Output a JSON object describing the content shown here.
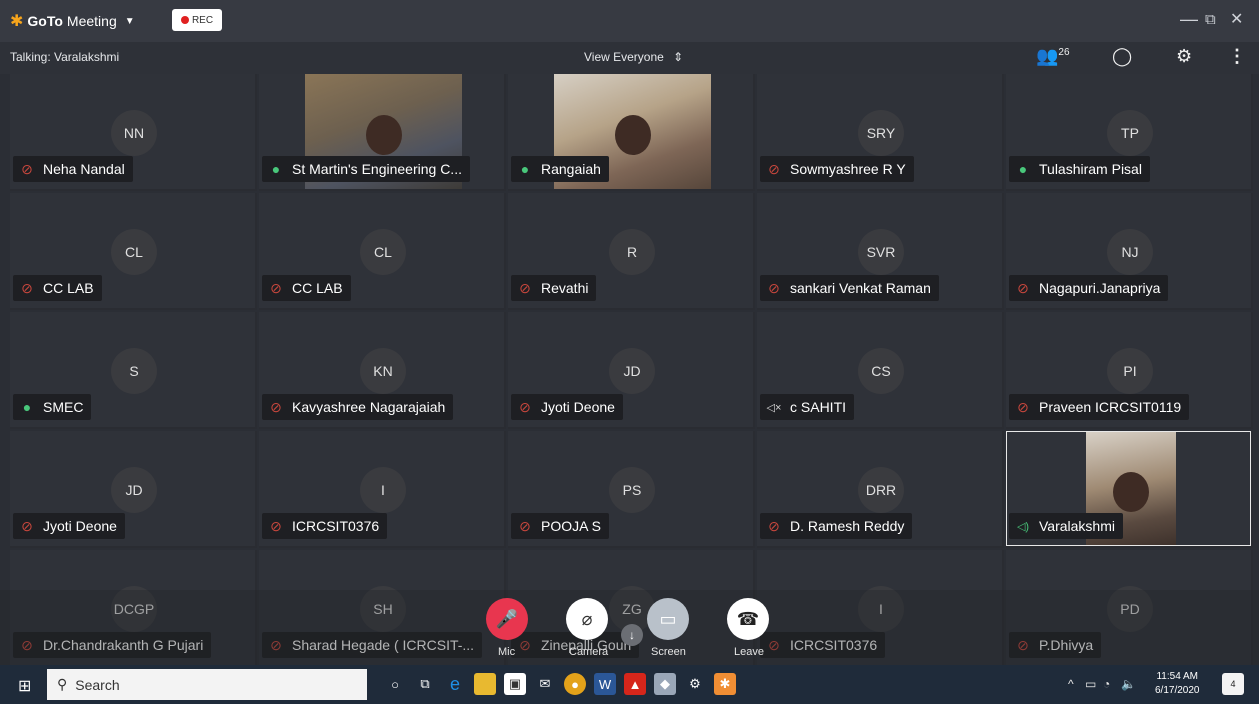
{
  "app": {
    "brand_prefix": "GoTo",
    "brand_suffix": "Meeting",
    "rec_label": "REC"
  },
  "window": {
    "minimize": "—",
    "restore": "⧉",
    "close": "✕"
  },
  "infobar": {
    "talking": "Talking: Varalakshmi",
    "view_label": "View Everyone",
    "attendee_count": "26"
  },
  "participants": [
    {
      "initials": "NN",
      "name": "Neha Nandal",
      "status": "muted",
      "video": false
    },
    {
      "initials": "",
      "name": "St Martin's Engineering C...",
      "status": "live",
      "video": true,
      "video_style": "v1"
    },
    {
      "initials": "",
      "name": "Rangaiah",
      "status": "live",
      "video": true,
      "video_style": "v2"
    },
    {
      "initials": "SRY",
      "name": "Sowmyashree R Y",
      "status": "muted",
      "video": false
    },
    {
      "initials": "TP",
      "name": "Tulashiram Pisal",
      "status": "live",
      "video": false
    },
    {
      "initials": "CL",
      "name": "CC LAB",
      "status": "muted",
      "video": false
    },
    {
      "initials": "CL",
      "name": "CC LAB",
      "status": "muted",
      "video": false
    },
    {
      "initials": "R",
      "name": "Revathi",
      "status": "muted",
      "video": false
    },
    {
      "initials": "SVR",
      "name": "sankari Venkat Raman",
      "status": "muted",
      "video": false
    },
    {
      "initials": "NJ",
      "name": "Nagapuri.Janapriya",
      "status": "muted",
      "video": false
    },
    {
      "initials": "S",
      "name": "SMEC",
      "status": "live",
      "video": false
    },
    {
      "initials": "KN",
      "name": "Kavyashree Nagarajaiah",
      "status": "muted",
      "video": false
    },
    {
      "initials": "JD",
      "name": "Jyoti Deone",
      "status": "muted",
      "video": false
    },
    {
      "initials": "CS",
      "name": "c SAHITI",
      "status": "silent",
      "video": false
    },
    {
      "initials": "PI",
      "name": "Praveen ICRCSIT0119",
      "status": "muted",
      "video": false
    },
    {
      "initials": "JD",
      "name": "Jyoti Deone",
      "status": "muted",
      "video": false
    },
    {
      "initials": "I",
      "name": "ICRCSIT0376",
      "status": "muted",
      "video": false
    },
    {
      "initials": "PS",
      "name": "POOJA S",
      "status": "muted",
      "video": false
    },
    {
      "initials": "DRR",
      "name": "D. Ramesh Reddy",
      "status": "muted",
      "video": false
    },
    {
      "initials": "",
      "name": "Varalakshmi",
      "status": "sound",
      "video": true,
      "video_style": "v3",
      "speaking": true
    },
    {
      "initials": "DCGP",
      "name": "Dr.Chandrakanth G Pujari",
      "status": "muted",
      "video": false
    },
    {
      "initials": "SH",
      "name": "Sharad Hegade ( ICRCSIT-...",
      "status": "muted",
      "video": false
    },
    {
      "initials": "ZG",
      "name": "Zinepalli Gouri",
      "status": "muted",
      "video": false
    },
    {
      "initials": "I",
      "name": "ICRCSIT0376",
      "status": "muted",
      "video": false
    },
    {
      "initials": "PD",
      "name": "P.Dhivya",
      "status": "muted",
      "video": false
    }
  ],
  "controls": {
    "mic": "Mic",
    "camera": "Camera",
    "screen": "Screen",
    "leave": "Leave"
  },
  "colors": {
    "mic_bg": "#e8364f",
    "camera_bg": "#ffffff",
    "screen_bg": "#b9c1ca",
    "leave_bg": "#ffffff"
  },
  "taskbar": {
    "search_placeholder": "Search",
    "time": "11:54 AM",
    "date": "6/17/2020",
    "notifications": "4"
  }
}
